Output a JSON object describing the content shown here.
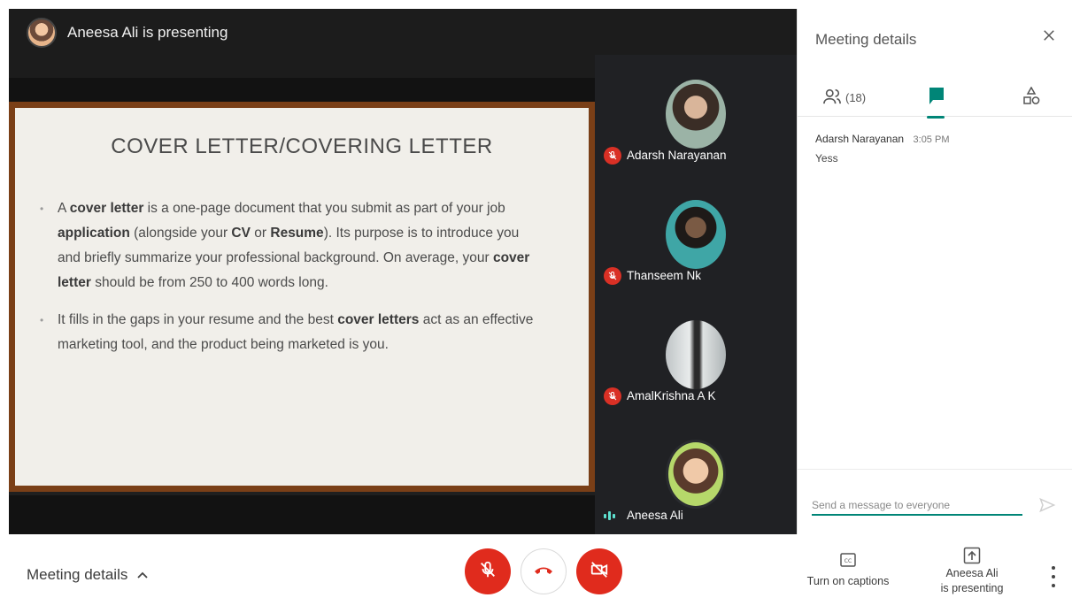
{
  "presenter_banner": {
    "text": "Aneesa Ali is presenting"
  },
  "slide": {
    "title": "COVER LETTER/COVERING LETTER",
    "bullet1": [
      {
        "t": "A ",
        "b": false
      },
      {
        "t": "cover letter",
        "b": true
      },
      {
        "t": " is a one-page document that you submit as part of your job ",
        "b": false
      },
      {
        "t": "application",
        "b": true
      },
      {
        "t": " (alongside your ",
        "b": false
      },
      {
        "t": "CV",
        "b": true
      },
      {
        "t": " or ",
        "b": false
      },
      {
        "t": "Resume",
        "b": true
      },
      {
        "t": "). Its purpose is to introduce you and briefly summarize your professional background. On average, your ",
        "b": false
      },
      {
        "t": "cover letter",
        "b": true
      },
      {
        "t": " should be from 250 to 400 words long.",
        "b": false
      }
    ],
    "bullet2": [
      {
        "t": "It fills in the gaps in your resume and the best ",
        "b": false
      },
      {
        "t": "cover letters",
        "b": true
      },
      {
        "t": " act as an effective marketing tool, and the product being marketed is you.",
        "b": false
      }
    ]
  },
  "participants": [
    {
      "name": "Adarsh Narayanan",
      "muted": true
    },
    {
      "name": "Thanseem Nk",
      "muted": true
    },
    {
      "name": "AmalKrishna A K",
      "muted": true
    },
    {
      "name": "Aneesa Ali",
      "muted": false
    }
  ],
  "panel": {
    "title": "Meeting details",
    "people_count": "(18)",
    "chat": [
      {
        "sender": "Adarsh Narayanan",
        "time": "3:05 PM",
        "message": "Yess"
      }
    ],
    "composer_placeholder": "Send a message to everyone"
  },
  "bottom_bar": {
    "meeting_details": "Meeting details",
    "captions": "Turn on captions",
    "presenting_line1": "Aneesa Ali",
    "presenting_line2": "is presenting"
  },
  "colors": {
    "accent": "#008577",
    "danger": "#e02b1d",
    "stage": "#1f1f1f",
    "slide_border": "#7a3f17"
  }
}
